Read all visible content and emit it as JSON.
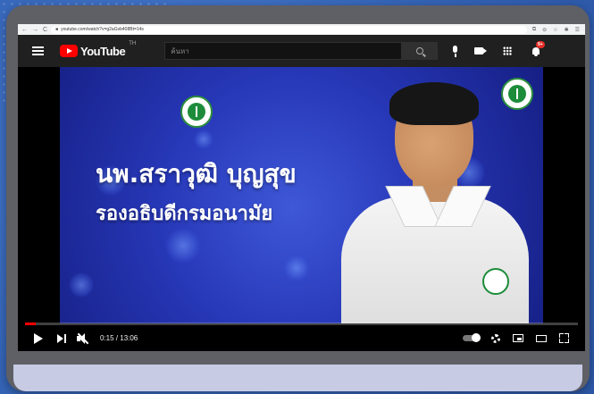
{
  "browser": {
    "url": "youtube.com/watch?v=g2aGvb408Bt=14s",
    "nav_back": "←",
    "nav_forward": "→",
    "nav_reload": "C",
    "ext_icons": [
      "⧉",
      "⊖",
      "☆",
      "✱",
      "☰"
    ]
  },
  "youtube": {
    "logo_text": "YouTube",
    "country_code": "TH",
    "search_placeholder": "ค้นหา",
    "notification_count": "9+"
  },
  "video": {
    "title_line1": "นพ.สราวุฒิ บุญสุข",
    "title_line2": "รองอธิบดีกรมอนามัย",
    "current_time": "0:15",
    "duration": "13:06",
    "time_display": "0:15 / 13:06",
    "progress_fraction": 0.019
  },
  "colors": {
    "accent_red": "#ff0000",
    "header_bg": "#202020",
    "page_bg": "#3b6cc0"
  },
  "icons": [
    "menu-icon",
    "search-icon",
    "mic-icon",
    "create-video-icon",
    "apps-grid-icon",
    "bell-icon",
    "play-icon",
    "next-icon",
    "volume-muted-icon",
    "autoplay-toggle",
    "settings-gear-icon",
    "miniplayer-icon",
    "theater-mode-icon",
    "fullscreen-icon"
  ]
}
